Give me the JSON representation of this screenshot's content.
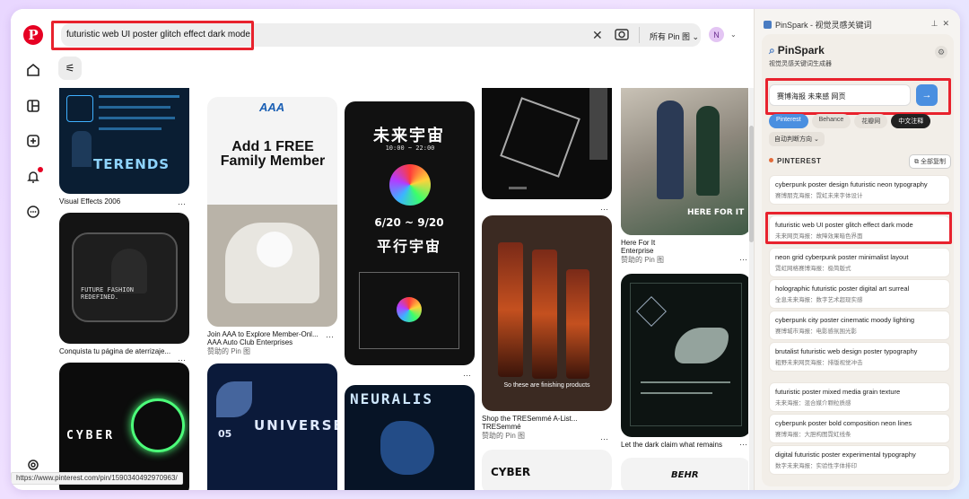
{
  "app": {
    "logo_letter": "P"
  },
  "search": {
    "query": "futuristic web UI poster glitch effect dark mode",
    "filter_label": "所有 Pin 图 ⌄"
  },
  "user": {
    "avatar_initial": "N"
  },
  "status_url": "https://www.pinterest.com/pin/1590340492970963/",
  "feed": {
    "col1": [
      {
        "title": "Visual Effects 2006",
        "img_text": "TERENDS"
      },
      {
        "title": "Conquista tu página de aterrizaje...",
        "img_text": "FUTURE FASHION REDEFINED."
      },
      {
        "title": "",
        "img_text": "CYBER"
      }
    ],
    "col2": [
      {
        "title": "Join AAA to Explore Member-Onl...",
        "sub": "AAA Auto Club Enterprises",
        "meta": "赞助的 Pin 图",
        "img_text": "Add 1 FREE Family Member",
        "logo": "AAA"
      },
      {
        "title": "",
        "img_text": "UNIVERSE",
        "num": "05"
      }
    ],
    "col3": [
      {
        "title": "",
        "img_text": "平行宇宙",
        "date1": "10:00 ~ 22:00",
        "date2": "6/20 ~ 9/20"
      },
      {
        "title": "",
        "img_text": "NEURALIS"
      }
    ],
    "col4": [
      {
        "title": "",
        "img_text": ""
      },
      {
        "title": "Shop the TRESemmé A-List...",
        "sub": "TRESemmé",
        "meta": "赞助的 Pin 图",
        "img_text": "So these are finishing products"
      },
      {
        "title": "",
        "img_text": "CYBER"
      }
    ],
    "col5": [
      {
        "title": "Here For It",
        "sub": "Enterprise",
        "meta": "赞助的 Pin 图",
        "img_text": "HERE FOR IT"
      },
      {
        "title": "Let the dark claim what remains",
        "img_text": ""
      },
      {
        "title": "",
        "img_text": "BEHR"
      }
    ]
  },
  "panel": {
    "window_title": "PinSpark - 视觉灵感关键词",
    "brand": "PinSpark",
    "brand_sub": "视觉灵感关键词生成器",
    "input_value": "赛博海报 未来感 网页",
    "chips": [
      "Pinterest",
      "Behance",
      "花瓣网",
      "中文注释"
    ],
    "direction": "自动判断方向 ⌄",
    "section": "PINTEREST",
    "copy_all": "全部复制",
    "suggestions": [
      {
        "en": "cyberpunk poster design futuristic neon typography",
        "zh": "赛博朋克海报：霓虹未来字体设计"
      },
      {
        "en": "futuristic web UI poster glitch effect dark mode",
        "zh": "未来网页海报：故障效果暗色界面"
      },
      {
        "en": "neon grid cyberpunk poster minimalist layout",
        "zh": "霓虹网格赛博海报：极简版式"
      },
      {
        "en": "holographic futuristic poster digital art surreal",
        "zh": "全息未来海报：数字艺术超现实感"
      },
      {
        "en": "cyberpunk city poster cinematic moody lighting",
        "zh": "赛博城市海报：电影感氛围光影"
      },
      {
        "en": "brutalist futuristic web design poster typography",
        "zh": "粗野未来网页海报：排版视觉冲击"
      },
      {
        "en": "futuristic poster mixed media grain texture",
        "zh": "未来海报：混合媒介颗粒质感"
      },
      {
        "en": "cyberpunk poster bold composition neon lines",
        "zh": "赛博海报：大胆构图霓虹线条"
      },
      {
        "en": "digital futuristic poster experimental typography",
        "zh": "数字未来海报：实验性字体排印"
      }
    ]
  }
}
